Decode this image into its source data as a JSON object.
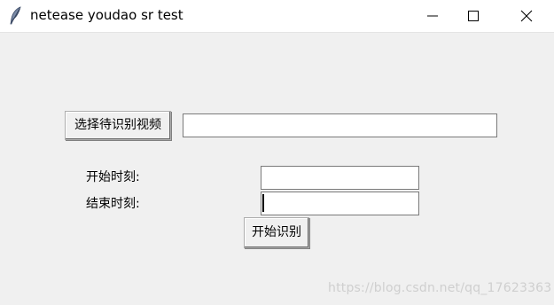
{
  "window": {
    "title": "netease youdao sr test",
    "icon": "feather-icon"
  },
  "controls": {
    "select_video_label": "选择待识别视频",
    "video_path_value": "",
    "start_time_label": "开始时刻:",
    "start_time_value": "",
    "end_time_label": "结束时刻:",
    "end_time_value": "",
    "start_button_label": "开始识别"
  },
  "watermark": "https://blog.csdn.net/qq_17623363",
  "colors": {
    "window_bg": "#f0f0f0",
    "titlebar_bg": "#ffffff",
    "entry_bg": "#ffffff",
    "entry_border": "#7a7a7a",
    "button_border": "#adadad",
    "watermark": "#cfcfcf"
  }
}
